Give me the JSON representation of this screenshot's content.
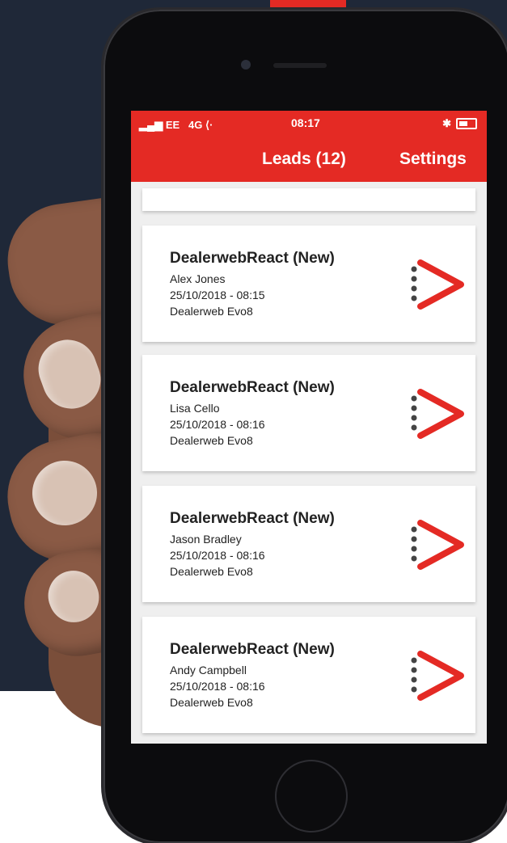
{
  "statusbar": {
    "carrier": "EE",
    "network": "4G",
    "time": "08:17",
    "bluetooth_glyph": "✱"
  },
  "navbar": {
    "title": "Leads (12)",
    "settings_label": "Settings"
  },
  "leads": [
    {
      "title": "DealerwebReact (New)",
      "name": "Alex Jones",
      "datetime": "25/10/2018 - 08:15",
      "source": "Dealerweb Evo8"
    },
    {
      "title": "DealerwebReact (New)",
      "name": "Lisa  Cello",
      "datetime": "25/10/2018 - 08:16",
      "source": "Dealerweb Evo8"
    },
    {
      "title": "DealerwebReact (New)",
      "name": "Jason Bradley",
      "datetime": "25/10/2018 - 08:16",
      "source": "Dealerweb Evo8"
    },
    {
      "title": "DealerwebReact (New)",
      "name": "Andy Campbell",
      "datetime": "25/10/2018 - 08:16",
      "source": "Dealerweb Evo8"
    }
  ],
  "colors": {
    "brand_red": "#e42a24",
    "background_navy": "#1f2838",
    "icon_dots": "#444444"
  },
  "icons": {
    "lead_open": "dealerweb-chevron-icon",
    "battery": "battery-icon",
    "bluetooth": "bluetooth-icon",
    "signal": "signal-icon"
  }
}
